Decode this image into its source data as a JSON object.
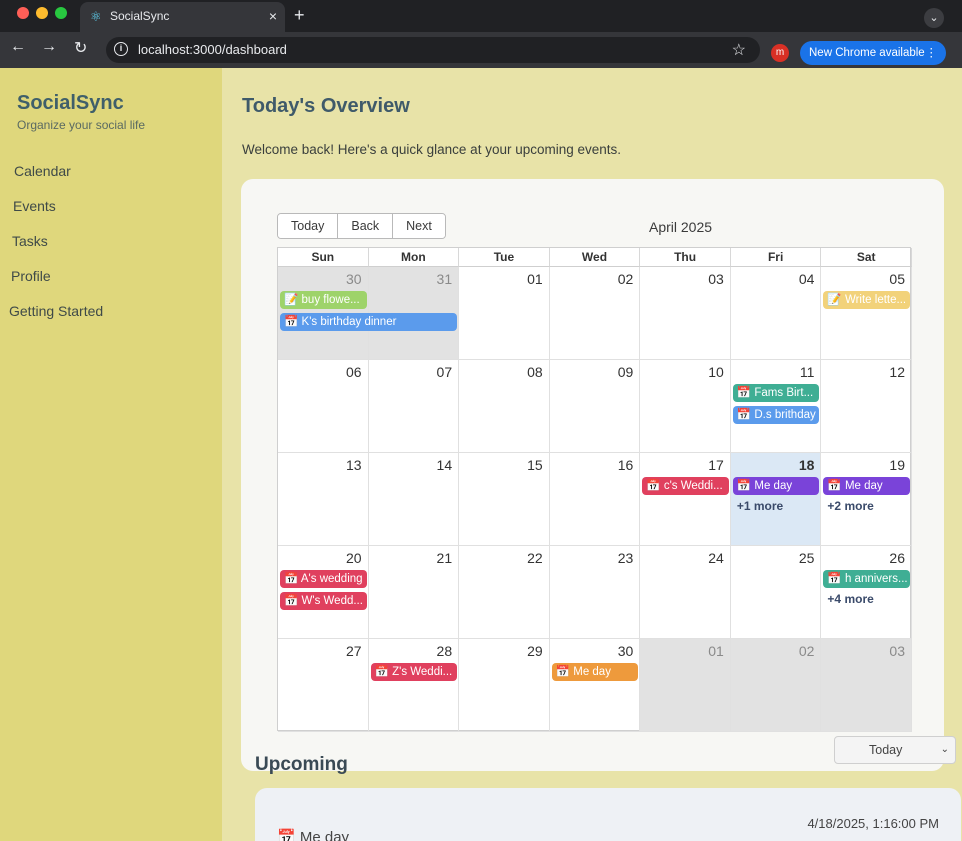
{
  "browser": {
    "tab_title": "SocialSync",
    "tab_close": "×",
    "new_tab": "+",
    "tab_dropdown": "⌄",
    "back": "←",
    "forward": "→",
    "reload": "↻",
    "url": "localhost:3000/dashboard",
    "star": "☆",
    "profile_initial": "m",
    "update_label": "New Chrome available",
    "menu": "⋮"
  },
  "sidebar": {
    "brand": "SocialSync",
    "tagline": "Organize your social life",
    "items": [
      {
        "label": "Calendar"
      },
      {
        "label": "Events"
      },
      {
        "label": "Tasks"
      },
      {
        "label": "Profile"
      },
      {
        "label": "Getting Started"
      }
    ]
  },
  "main": {
    "title": "Today's Overview",
    "welcome": "Welcome back! Here's a quick glance at your upcoming events."
  },
  "calendar": {
    "buttons": {
      "today": "Today",
      "back": "Back",
      "next": "Next"
    },
    "month_label": "April 2025",
    "weekdays": [
      "Sun",
      "Mon",
      "Tue",
      "Wed",
      "Thu",
      "Fri",
      "Sat"
    ],
    "weeks": [
      [
        {
          "d": "30",
          "off": true
        },
        {
          "d": "31",
          "off": true
        },
        {
          "d": "01"
        },
        {
          "d": "02"
        },
        {
          "d": "03"
        },
        {
          "d": "04"
        },
        {
          "d": "05"
        }
      ],
      [
        {
          "d": "06"
        },
        {
          "d": "07"
        },
        {
          "d": "08"
        },
        {
          "d": "09"
        },
        {
          "d": "10"
        },
        {
          "d": "11"
        },
        {
          "d": "12"
        }
      ],
      [
        {
          "d": "13"
        },
        {
          "d": "14"
        },
        {
          "d": "15"
        },
        {
          "d": "16"
        },
        {
          "d": "17"
        },
        {
          "d": "18",
          "today": true
        },
        {
          "d": "19"
        }
      ],
      [
        {
          "d": "20"
        },
        {
          "d": "21"
        },
        {
          "d": "22"
        },
        {
          "d": "23"
        },
        {
          "d": "24"
        },
        {
          "d": "25"
        },
        {
          "d": "26"
        }
      ],
      [
        {
          "d": "27"
        },
        {
          "d": "28"
        },
        {
          "d": "29"
        },
        {
          "d": "30"
        },
        {
          "d": "01",
          "off": true
        },
        {
          "d": "02",
          "off": true
        },
        {
          "d": "03",
          "off": true
        }
      ]
    ],
    "events": [
      {
        "week": 0,
        "day": 0,
        "span": 1,
        "slot": 0,
        "icon": "📝",
        "label": "buy flowe...",
        "color": "#9ed36a"
      },
      {
        "week": 0,
        "day": 0,
        "span": 2,
        "slot": 1,
        "icon": "📅",
        "label": "K's birthday dinner",
        "color": "#5b9bec"
      },
      {
        "week": 0,
        "day": 6,
        "span": 1,
        "slot": 0,
        "icon": "📝",
        "label": "Write lette...",
        "color": "#f2d27a"
      },
      {
        "week": 1,
        "day": 5,
        "span": 1,
        "slot": 0,
        "icon": "📅",
        "label": "Fams Birt...",
        "color": "#3fae94"
      },
      {
        "week": 1,
        "day": 5,
        "span": 1,
        "slot": 1,
        "icon": "📅",
        "label": "D.s brithday",
        "color": "#5b9bec"
      },
      {
        "week": 2,
        "day": 4,
        "span": 1,
        "slot": 0,
        "icon": "📅",
        "label": "c's Weddi...",
        "color": "#e0405e"
      },
      {
        "week": 2,
        "day": 5,
        "span": 1,
        "slot": 0,
        "icon": "📅",
        "label": "Me day",
        "color": "#7a43d9"
      },
      {
        "week": 2,
        "day": 6,
        "span": 1,
        "slot": 0,
        "icon": "📅",
        "label": "Me day",
        "color": "#7a43d9"
      },
      {
        "week": 3,
        "day": 0,
        "span": 1,
        "slot": 0,
        "icon": "📅",
        "label": "A's wedding",
        "color": "#e0405e"
      },
      {
        "week": 3,
        "day": 0,
        "span": 1,
        "slot": 1,
        "icon": "📅",
        "label": "W's Wedd...",
        "color": "#e0405e"
      },
      {
        "week": 3,
        "day": 6,
        "span": 1,
        "slot": 0,
        "icon": "📅",
        "label": "h annivers...",
        "color": "#3fae94"
      },
      {
        "week": 4,
        "day": 1,
        "span": 1,
        "slot": 0,
        "icon": "📅",
        "label": "Z's Weddi...",
        "color": "#e0405e"
      },
      {
        "week": 4,
        "day": 3,
        "span": 1,
        "slot": 0,
        "icon": "📅",
        "label": "Me day",
        "color": "#ee9a3c"
      }
    ],
    "more_links": [
      {
        "week": 2,
        "day": 5,
        "label": "+1 more"
      },
      {
        "week": 2,
        "day": 6,
        "label": "+2 more"
      },
      {
        "week": 3,
        "day": 6,
        "label": "+4 more"
      }
    ]
  },
  "upcoming": {
    "title": "Upcoming",
    "filter_value": "Today",
    "chevron": "⌄",
    "first_item": {
      "icon": "📅",
      "name": "Me day",
      "datetime": "4/18/2025, 1:16:00 PM"
    }
  }
}
